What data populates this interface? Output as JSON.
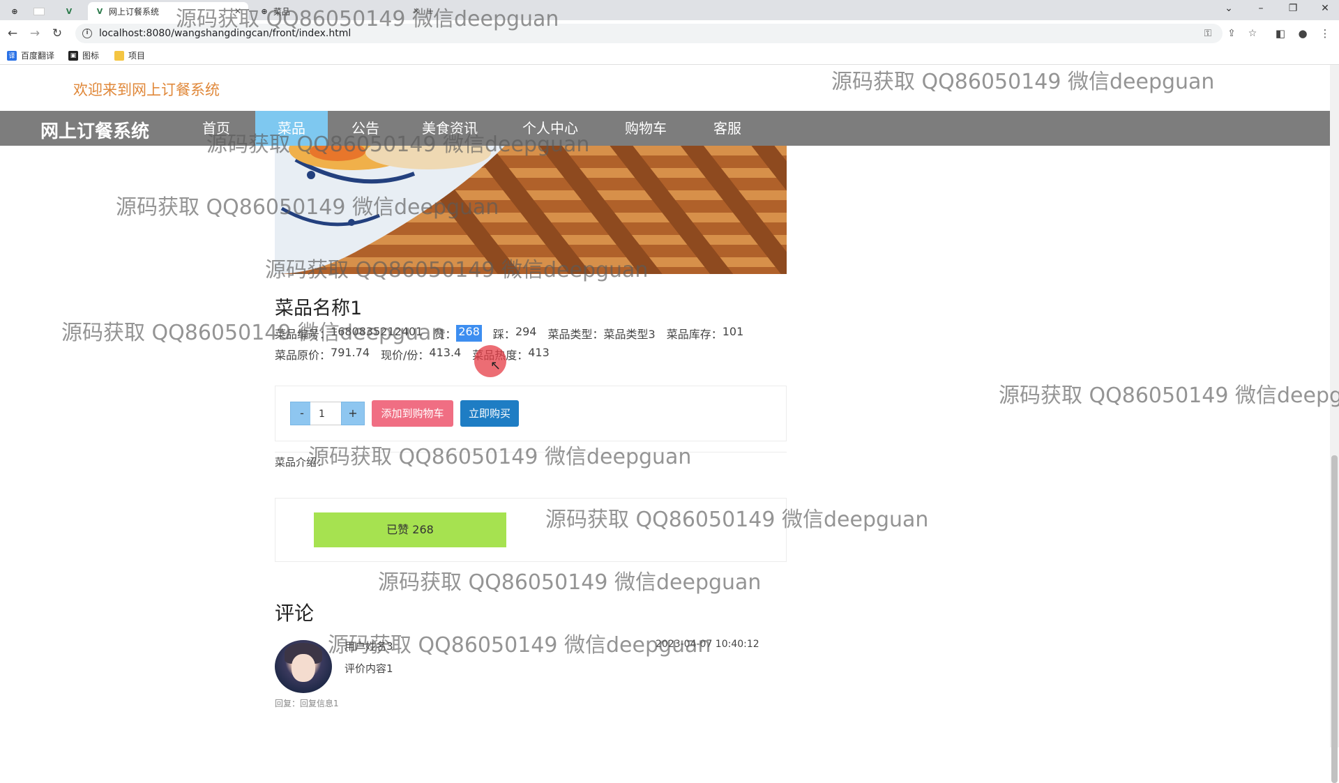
{
  "browser": {
    "tabs": [
      {
        "title": "",
        "active": false
      },
      {
        "title": "",
        "active": false
      },
      {
        "title": "网上订餐系统",
        "active": true
      },
      {
        "title": "菜品",
        "active": false
      }
    ],
    "url": "localhost:8080/wangshangdingcan/front/index.html",
    "bookmarks": [
      "百度翻译",
      "图标",
      "项目"
    ]
  },
  "header": {
    "welcome": "欢迎来到网上订餐系统",
    "brand": "网上订餐系统",
    "nav": [
      "首页",
      "菜品",
      "公告",
      "美食资讯",
      "个人中心",
      "购物车",
      "客服"
    ]
  },
  "product": {
    "name": "菜品名称1",
    "code_label": "菜品编号：",
    "code": "1680835212401",
    "like_label": "赞：",
    "like": "268",
    "dislike_label": "踩：",
    "dislike": "294",
    "type_label": "菜品类型：",
    "type": "菜品类型3",
    "stock_label": "菜品库存：",
    "stock": "101",
    "orig_price_label": "菜品原价：",
    "orig_price": "791.74",
    "price_label": "现价/份：",
    "price": "413.4",
    "heat_label": "菜品热度：",
    "heat": "413"
  },
  "cart": {
    "minus": "-",
    "qty": "1",
    "plus": "+",
    "add_label": "添加到购物车",
    "buy_label": "立即购买"
  },
  "intro_label": "菜品介绍：",
  "like_button": "已赞   268",
  "comments": {
    "title": "评论",
    "items": [
      {
        "user": "用户姓名3",
        "time": "2023-04-07 10:40:12",
        "content": "评价内容1",
        "reply": "回复：回复信息1"
      }
    ]
  },
  "watermark": "源码获取 QQ86050149 微信deepguan",
  "colors": {
    "nav_bg": "#7d7d7d",
    "nav_active": "#7ec8f0",
    "welcome": "#e0883a",
    "add_cart": "#f06e83",
    "buy_now": "#1e7dc4",
    "liked": "#a6e250"
  }
}
